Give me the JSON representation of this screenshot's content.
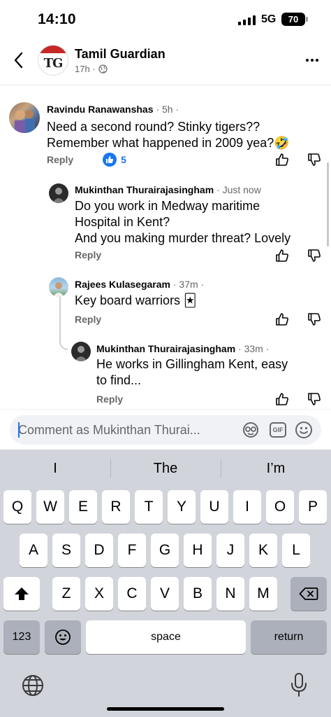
{
  "status_bar": {
    "time": "14:10",
    "network": "5G",
    "battery": "70"
  },
  "header": {
    "page_name": "Tamil Guardian",
    "logo_text": "TG",
    "meta": "17h ·"
  },
  "comments": [
    {
      "author": "Ravindu Ranawanshas",
      "time": " · 5h ·",
      "text_lines": [
        "Need a second round? Stinky tigers??",
        "Remember what happened in 2009 yea?🤣"
      ],
      "reply_label": "Reply",
      "reaction_count": "5"
    },
    {
      "author": "Mukinthan Thurairajasingham",
      "time": " · Just now",
      "text_lines": [
        "Do you work in Medway maritime",
        "Hospital in Kent?",
        "And you making murder threat? Lovely"
      ],
      "reply_label": "Reply"
    },
    {
      "author": "Rajees Kulasegaram",
      "time": " · 37m ·",
      "text_lines": [
        "Key board warriors 🃏"
      ],
      "reply_label": "Reply"
    },
    {
      "author": "Mukinthan Thurairajasingham",
      "time": " · 33m ·",
      "text_lines": [
        "He works in Gillingham Kent, easy",
        "to find..."
      ],
      "reply_label": "Reply"
    }
  ],
  "composer": {
    "placeholder": "Comment as Mukinthan Thurai...",
    "gif_label": "GIF"
  },
  "keyboard": {
    "suggestions": [
      "I",
      "The",
      "I’m"
    ],
    "row1": [
      "Q",
      "W",
      "E",
      "R",
      "T",
      "Y",
      "U",
      "I",
      "O",
      "P"
    ],
    "row2": [
      "A",
      "S",
      "D",
      "F",
      "G",
      "H",
      "J",
      "K",
      "L"
    ],
    "row3": [
      "Z",
      "X",
      "C",
      "V",
      "B",
      "N",
      "M"
    ],
    "numbers_label": "123",
    "space_label": "space",
    "return_label": "return"
  },
  "colors": {
    "accent": "#1877f2",
    "secondary_text": "#65676b",
    "keyboard_bg": "#d1d4db"
  }
}
